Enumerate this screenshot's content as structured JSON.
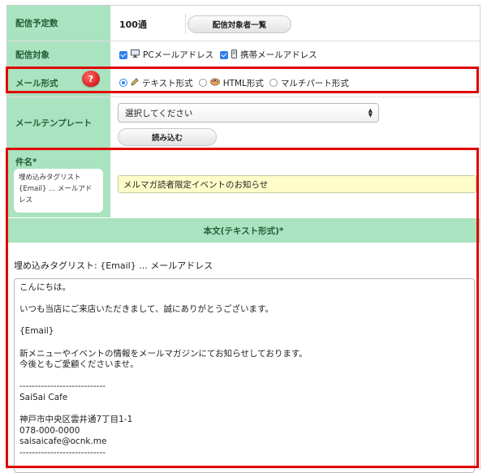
{
  "rows": {
    "count": {
      "label": "配信予定数",
      "value": "100通",
      "list_button": "配信対象者一覧"
    },
    "target": {
      "label": "配信対象",
      "options": [
        {
          "label": "PCメールアドレス",
          "checked": true,
          "icon": "desktop-icon"
        },
        {
          "label": "携帯メールアドレス",
          "checked": true,
          "icon": "mobile-phone-icon"
        }
      ]
    },
    "format": {
      "label": "メール形式",
      "help_icon": "?",
      "options": [
        {
          "label": "テキスト形式",
          "selected": true,
          "icon": "pen-icon"
        },
        {
          "label": "HTML形式",
          "selected": false,
          "icon": "palette-icon"
        },
        {
          "label": "マルチパート形式",
          "selected": false
        }
      ]
    },
    "template": {
      "label": "メールテンプレート",
      "select_value": "選択してください",
      "load_button": "読み込む"
    },
    "subject": {
      "label": "件名*",
      "taglist_title": "埋め込みタグリスト",
      "taglist_item": "{Email} ... メールアドレス",
      "value": "メルマガ読者限定イベントのお知らせ"
    }
  },
  "body": {
    "header": "本文(テキスト形式)*",
    "taglist": "埋め込みタグリスト: {Email} ... メールアドレス",
    "lines": [
      "こんにちは。",
      "",
      "いつも当店にご来店いただきまして、誠にありがとうございます。",
      "",
      "{Email}",
      "",
      "新メニューやイベントの情報をメールマガジンにてお知らせしております。",
      "今後ともご愛顧くださいませ。",
      "",
      "----------------------------",
      "SaiSai Cafe",
      "",
      "神戸市中央区雲井通7丁目1-1",
      "078-000-0000",
      "saisaicafe@ocnk.me",
      "----------------------------"
    ]
  },
  "colors": {
    "label_bg": "#a9e3bf",
    "highlight_border": "#e10000",
    "subject_bg": "#fefcc8",
    "accent": "#2d7ff0"
  }
}
